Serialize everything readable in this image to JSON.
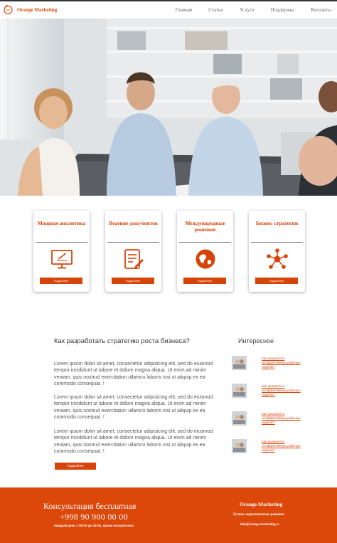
{
  "header": {
    "brand": "Orange Marketing",
    "nav": [
      "Главная",
      "Статьи",
      "Услуги",
      "Поддержка",
      "Контакты"
    ]
  },
  "hero": {
    "image": "office-team-meeting-photo"
  },
  "services": [
    {
      "title": "Мощная аналитика",
      "icon": "monitor-analytics-icon",
      "button": "Подробнее"
    },
    {
      "title": "Ведение документов",
      "icon": "document-edit-icon",
      "button": "Подробнее"
    },
    {
      "title": "Международные решения",
      "icon": "globe-icon",
      "button": "Подробнее"
    },
    {
      "title": "Бизнес стратегии",
      "icon": "network-nodes-icon",
      "button": "Подробнее"
    }
  ],
  "article": {
    "title": "Как разработать стратегию роста бизнеса?",
    "paragraphs": [
      "Lorem ipsum dolor sit amet, consectetur adipisicing elit, sed do eiusmod tempor incididunt ut labore et dolore magna aliqua. Ut enim ad minim veniam, quis nostrud exercitation ullamco laboris nisi ut aliquip ex ea commodo consequat. !",
      "Lorem ipsum dolor sit amet, consectetur adipisicing elit, sed do eiusmod tempor incididunt ut labore et dolore magna aliqua. Ut enim ad minim veniam, quis nostrud exercitation ullamco laboris nisi ut aliquip ex ea commodo consequat. !",
      "Lorem ipsum dolor sit amet, consectetur adipisicing elit, sed do eiusmod tempor incididunt ut labore et dolore magna aliqua. Ut enim ad minim veniam, quis nostrud exercitation ullamco laboris nisi ut aliquip ex ea commodo consequat. !"
    ],
    "button": "Подробнее"
  },
  "sidebar": {
    "title": "Интересное",
    "items": [
      {
        "link": "Как прекратить неэффективную рабочую неделю?"
      },
      {
        "link": "Как прекратить неэффективную рабочую неделю?"
      },
      {
        "link": "Как прекратить неэффективную рабочую неделю?"
      },
      {
        "link": "Как прекратить неэффективную рабочую неделю?"
      }
    ]
  },
  "footer": {
    "heading": "Консультация бесплатная",
    "phone": "+998 90 900 00 00",
    "hours": "Каждый день с 09:00 до 18:00, кроме воскресенья",
    "brand": "Orange Marketing",
    "tagline": "Лучшие маркетинговые решения",
    "email": "info@orange-marketing.cc"
  },
  "colors": {
    "accent": "#d7440a",
    "footer_bg": "#dc470a"
  }
}
